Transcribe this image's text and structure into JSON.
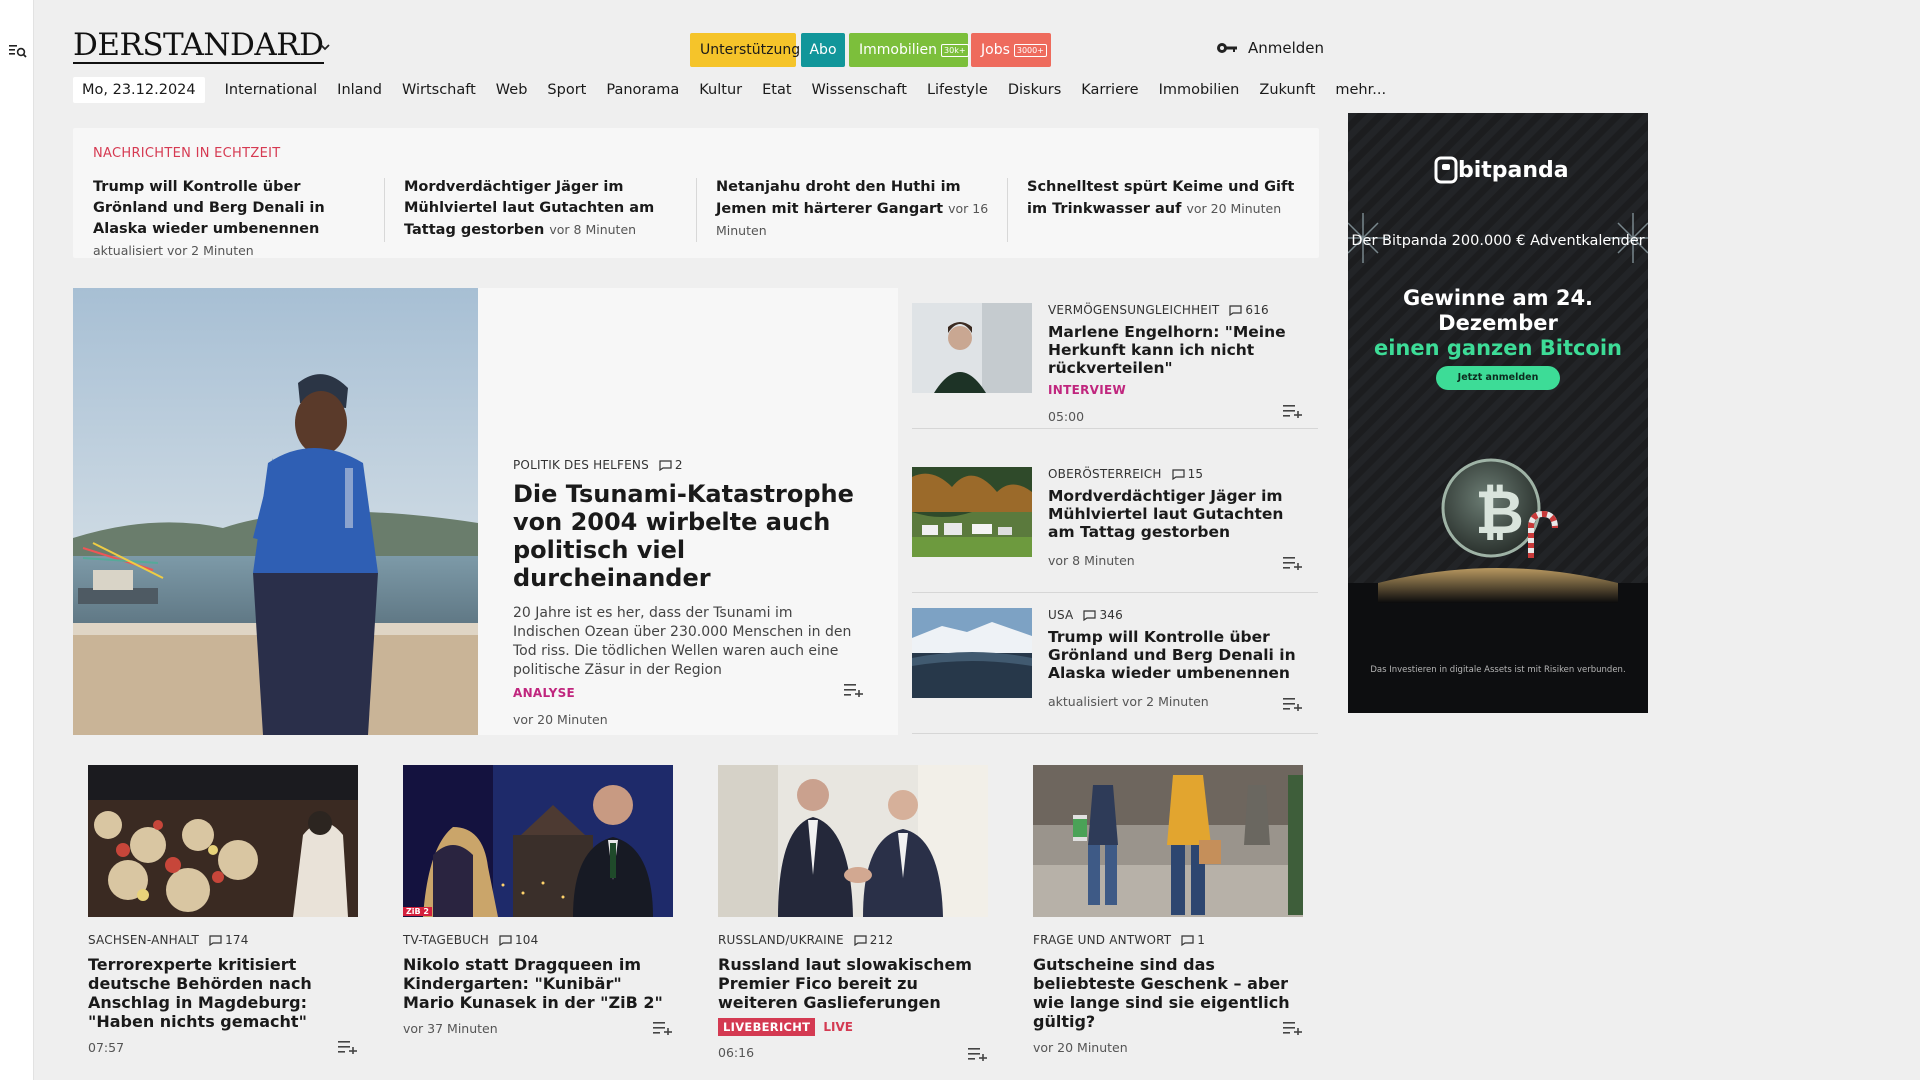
{
  "header": {
    "logo": "DERSTANDARD",
    "pills": {
      "support": "Unterstützung",
      "abo": "Abo",
      "immo": "Immobilien",
      "immo_badge": "30k+",
      "jobs": "Jobs",
      "jobs_badge": "3000+"
    },
    "login": "Anmelden"
  },
  "nav": {
    "date": "Mo, 23.12.2024",
    "items": [
      "International",
      "Inland",
      "Wirtschaft",
      "Web",
      "Sport",
      "Panorama",
      "Kultur",
      "Etat",
      "Wissenschaft",
      "Lifestyle",
      "Diskurs",
      "Karriere",
      "Immobilien",
      "Zukunft",
      "mehr..."
    ]
  },
  "ticker": {
    "label": "NACHRICHTEN IN ECHTZEIT",
    "items": [
      {
        "title": "Trump will Kontrolle über Grönland und Berg Denali in Alaska wieder um­benennen",
        "time": "aktualisiert vor 2 Minuten"
      },
      {
        "title": "Mordverdächtiger Jäger im Mühlvier­tel laut Gutachten am Tattag gestor­ben",
        "time": "vor 8 Minuten"
      },
      {
        "title": "Netanjahu droht den Huthi im Jemen mit härterer Gangart",
        "time": "vor 16 Minuten"
      },
      {
        "title": "Schnelltest spürt Keime und Gift im Trinkwasser auf",
        "time": "vor 20 Minuten"
      }
    ]
  },
  "hero": {
    "kicker": "POLITIK DES HELFENS",
    "comments": "2",
    "title": "Die Tsunami-Katastrophe von 2004 wirbelte auch politisch viel durcheinander",
    "lead": "20 Jahre ist es her, dass der Tsunami im Indischen Ozean über 230.000 Menschen in den Tod riss. Die tödlichen Wellen waren auch eine politische Zäsur in der Region",
    "tag": "ANALYSE",
    "time": "vor 20 Minuten"
  },
  "side": [
    {
      "kicker": "VERMÖGENSUNGLEICHHEIT",
      "comments": "616",
      "title": "Marlene Engelhorn: \"Meine Herkunft kann ich nicht rückverteilen\"",
      "tag": "INTERVIEW",
      "time": "05:00"
    },
    {
      "kicker": "OBERÖSTERREICH",
      "comments": "15",
      "title": "Mordverdächtiger Jäger im Mühlviertel laut Gutachten am Tattag gestorben",
      "time": "vor 8 Minuten"
    },
    {
      "kicker": "USA",
      "comments": "346",
      "title": "Trump will Kontrolle über Grönland und Berg Denali in Alaska wieder umbenennen",
      "time": "aktualisiert vor 2 Minuten"
    }
  ],
  "cards": [
    {
      "kicker": "SACHSEN-ANHALT",
      "comments": "174",
      "title": "Terrorexperte kritisiert deutsche Behörden nach Anschlag in Magdeburg: \"Haben nichts gemacht\"",
      "time": "07:57"
    },
    {
      "kicker": "TV-TAGEBUCH",
      "comments": "104",
      "title": "Nikolo statt Dragqueen im Kindergarten: \"Kunibär\" Mario Kunasek in der \"ZiB 2\"",
      "time": "vor 37 Minuten"
    },
    {
      "kicker": "RUSSLAND/UKRAINE",
      "comments": "212",
      "title": "Russland laut slowakischem Premier Fico bereit zu weiteren Gaslieferungen",
      "live_badge": "LIVEBERICHT",
      "live_text": "LIVE",
      "time": "06:16"
    },
    {
      "kicker": "FRAGE UND ANTWORT",
      "comments": "1",
      "title": "Gutscheine sind das beliebteste Geschenk – aber wie lange sind sie eigentlich gültig?",
      "time": "vor 20 Minuten"
    }
  ],
  "ad": {
    "brand": "bitpanda",
    "tagline": "Der Bitpanda 200.000 € Adventkalender",
    "headline1": "Gewinne am 24.",
    "headline2": "Dezember",
    "headline3": "einen ganzen Bitcoin",
    "cta": "Jetzt anmelden",
    "disclaimer": "Das Investieren in digitale Assets ist mit Risiken verbunden.",
    "tv_label": "ZiB 2"
  },
  "colors": {
    "accent_red": "#d63a52",
    "tag_magenta": "#c0267e",
    "ad_green": "#3ddc97"
  }
}
